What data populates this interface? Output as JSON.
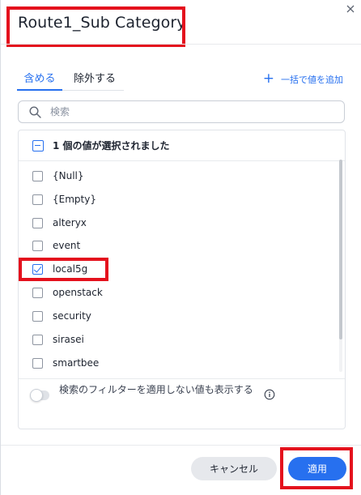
{
  "dialog": {
    "title": "Route1_Sub Category"
  },
  "tabs": [
    {
      "label": "含める",
      "active": true
    },
    {
      "label": "除外する",
      "active": false
    }
  ],
  "bulk_add": {
    "icon": "plus-icon",
    "label": "一括で値を追加"
  },
  "search": {
    "icon": "search-icon",
    "placeholder": "検索",
    "value": ""
  },
  "summary": {
    "text": "1 個の値が選択されました",
    "state": "indeterminate"
  },
  "items": [
    {
      "label": "{Null}",
      "checked": false
    },
    {
      "label": "{Empty}",
      "checked": false
    },
    {
      "label": "alteryx",
      "checked": false
    },
    {
      "label": "event",
      "checked": false
    },
    {
      "label": "local5g",
      "checked": true
    },
    {
      "label": "openstack",
      "checked": false
    },
    {
      "label": "security",
      "checked": false
    },
    {
      "label": "sirasei",
      "checked": false
    },
    {
      "label": "smartbee",
      "checked": false
    }
  ],
  "filter_toggle": {
    "label": "検索のフィルターを適用しない値も表示する",
    "enabled": false,
    "info_icon": "info-icon"
  },
  "buttons": {
    "cancel": "キャンセル",
    "apply": "適用"
  },
  "colors": {
    "accent": "#2770ef",
    "highlight_box": "#e4111d",
    "text": "#1d232f"
  }
}
